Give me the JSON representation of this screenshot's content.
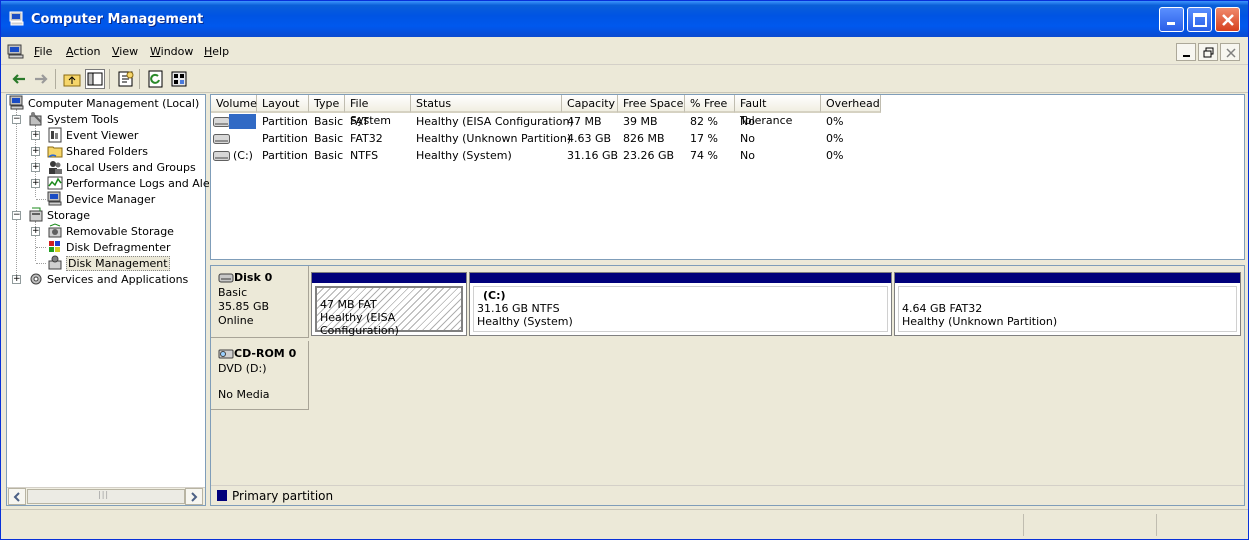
{
  "window": {
    "title": "Computer Management"
  },
  "menu": {
    "items": [
      {
        "label": "File",
        "key": "F"
      },
      {
        "label": "Action",
        "key": "A"
      },
      {
        "label": "View",
        "key": "V"
      },
      {
        "label": "Window",
        "key": "W"
      },
      {
        "label": "Help",
        "key": "H"
      }
    ]
  },
  "tree": {
    "root": "Computer Management (Local)",
    "system_tools": "System Tools",
    "event_viewer": "Event Viewer",
    "shared_folders": "Shared Folders",
    "local_users": "Local Users and Groups",
    "perf_logs": "Performance Logs and Alerts",
    "device_manager": "Device Manager",
    "storage": "Storage",
    "removable_storage": "Removable Storage",
    "disk_defrag": "Disk Defragmenter",
    "disk_management": "Disk Management",
    "services_apps": "Services and Applications",
    "scroll_thumb": "|||"
  },
  "volumes": {
    "columns": [
      "Volume",
      "Layout",
      "Type",
      "File System",
      "Status",
      "Capacity",
      "Free Space",
      "% Free",
      "Fault Tolerance",
      "Overhead"
    ],
    "rows": [
      {
        "volume": "",
        "layout": "Partition",
        "type": "Basic",
        "fs": "FAT",
        "status": "Healthy (EISA Configuration)",
        "capacity": "47 MB",
        "free": "39 MB",
        "pct": "82 %",
        "fault": "No",
        "overhead": "0%"
      },
      {
        "volume": "",
        "layout": "Partition",
        "type": "Basic",
        "fs": "FAT32",
        "status": "Healthy (Unknown Partition)",
        "capacity": "4.63 GB",
        "free": "826 MB",
        "pct": "17 %",
        "fault": "No",
        "overhead": "0%"
      },
      {
        "volume": "(C:)",
        "layout": "Partition",
        "type": "Basic",
        "fs": "NTFS",
        "status": "Healthy (System)",
        "capacity": "31.16 GB",
        "free": "23.26 GB",
        "pct": "74 %",
        "fault": "No",
        "overhead": "0%"
      }
    ]
  },
  "disks": {
    "disk0": {
      "name": "Disk 0",
      "type": "Basic",
      "size": "35.85 GB",
      "state": "Online",
      "partitions": [
        {
          "label": "",
          "size": "47 MB FAT",
          "status": "Healthy (EISA Configuration)"
        },
        {
          "label": "(C:)",
          "size": "31.16 GB NTFS",
          "status": "Healthy (System)"
        },
        {
          "label": "",
          "size": "4.64 GB FAT32",
          "status": "Healthy (Unknown Partition)"
        }
      ]
    },
    "cdrom0": {
      "name": "CD-ROM 0",
      "type": "DVD (D:)",
      "state": "No Media"
    }
  },
  "legend": {
    "primary": "Primary partition",
    "color": "#00007b"
  },
  "colors": {
    "title_bar": "#0054e3",
    "partition_bar": "#00007b",
    "selection": "#316ac5"
  }
}
